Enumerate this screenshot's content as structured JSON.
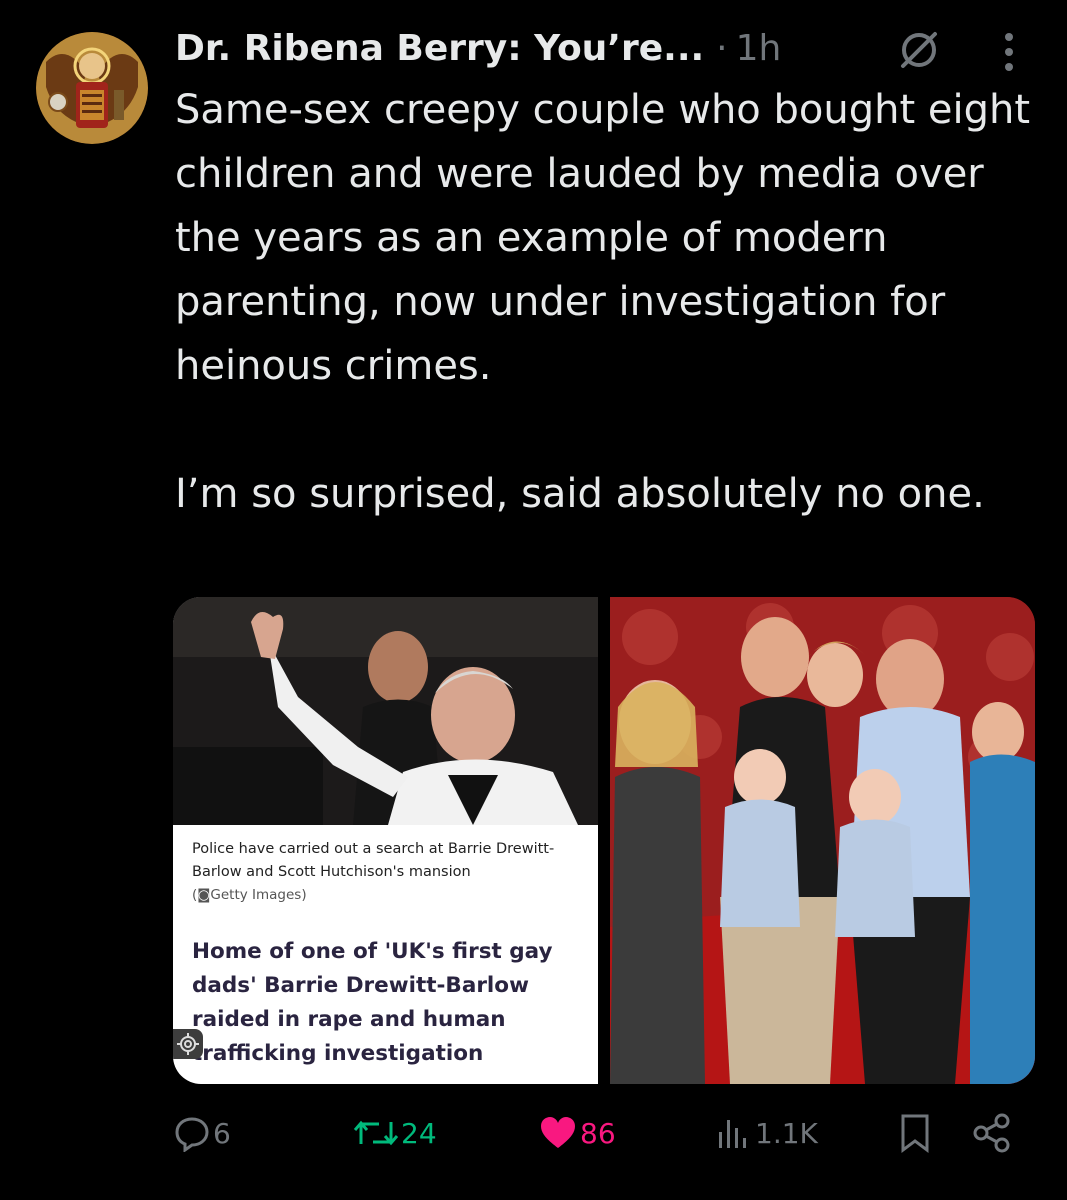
{
  "author": {
    "display_name": "Dr. Ribena Berry: You’re...",
    "separator": "·",
    "time": "1h"
  },
  "tweet": {
    "paragraph1": "Same-sex creepy couple who bought eight children and were lauded by media over the years as an example of modern parenting, now under investigation for heinous crimes.",
    "paragraph2": "I’m so surprised, said absolutely no one."
  },
  "media": {
    "caption": "Police have carried out a search at Barrie Drewitt-Barlow and Scott Hutchison's mansion",
    "credit": "Getty Images",
    "credit_prefix": "(",
    "credit_suffix": ")",
    "headline": "Home of one of 'UK's first gay dads' Barrie Drewitt-Barlow raided in rape and human trafficking investigation"
  },
  "actions": {
    "replies": "6",
    "retweets": "24",
    "likes": "86",
    "views": "1.1K"
  },
  "icons": {
    "muted": "muted-icon",
    "more": "more-icon",
    "reply": "reply-icon",
    "retweet": "retweet-icon",
    "like": "heart-icon",
    "views": "views-icon",
    "bookmark": "bookmark-icon",
    "share": "share-icon",
    "settings": "gear-icon"
  },
  "colors": {
    "background": "#000000",
    "text": "#e7e9ea",
    "muted": "#71767b",
    "retweet": "#00ba7c",
    "like": "#f91880"
  }
}
